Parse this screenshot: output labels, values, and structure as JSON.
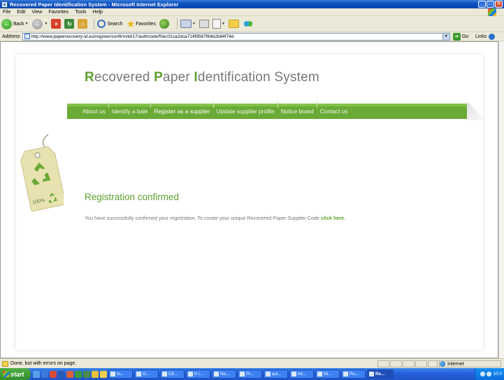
{
  "window": {
    "title": "Recovered Paper Identification System - Microsoft Internet Explorer",
    "min_label": "_",
    "max_label": "□",
    "close_label": "×"
  },
  "menu": {
    "items": [
      "File",
      "Edit",
      "View",
      "Favorites",
      "Tools",
      "Help"
    ]
  },
  "toolbar": {
    "back_label": "Back",
    "search_label": "Search",
    "favorites_label": "Favorites"
  },
  "address": {
    "label": "Address",
    "url": "http://www.paperrecovery-id.eu/register/confirm/id/17/authcode/f0ec01ca2dca714f9567f64b2b84f74d",
    "go_label": "Go",
    "links_label": "Links"
  },
  "page": {
    "brand": {
      "r_initial": "R",
      "r_rest": "ecovered ",
      "p_initial": "P",
      "p_rest": "aper ",
      "i_initial": "I",
      "i_rest": "dentification System"
    },
    "nav": [
      "About us",
      "Identify a bale",
      "Register as a supplier",
      "Update supplier profile",
      "Notice board",
      "Contact us"
    ],
    "tag_label": "100%",
    "heading": "Registration confirmed",
    "message": "You have successfully confirmed your registration. To create your unique Recovered Paper Supplier Code ",
    "link_text": "click here."
  },
  "status": {
    "text": "Done, but with errors on page.",
    "zone": "Internet"
  },
  "taskbar": {
    "start_label": "start",
    "tasks": [
      "In...",
      "G...",
      "CE...",
      "K:\\...",
      "Ne...",
      "Pr...",
      "qui...",
      "Int...",
      "Nt...",
      "Po...",
      "Re..."
    ],
    "clock": "10:0"
  },
  "colors": {
    "brand_green": "#5da02e",
    "nav_green": "#6aaa36",
    "xp_blue": "#245edb"
  }
}
